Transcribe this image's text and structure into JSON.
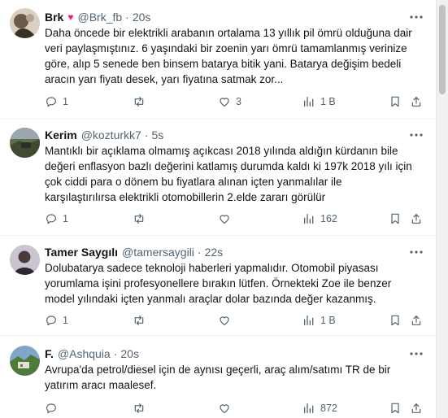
{
  "tweets": [
    {
      "name": "Brk",
      "heart": "♥",
      "handle": "@Brk_fb",
      "dot": "·",
      "time": "20s",
      "lines": [
        "Daha öncede bir elektrikli arabanın ortalama 13 yıllık pil ömrü olduğuna dair",
        "veri paylaşmıştınız. 6 yaşındaki bir zoenin yarı ömrü tamamlanmış verinize",
        "göre, alıp 5 senede ben binsem batarya bitik yani. Batarya değişim bedeli",
        "aracın yarı fiyatı desek, yarı fiyatına satmak zor..."
      ],
      "replies": "1",
      "retweets": "",
      "likes": "3",
      "views": "1 B"
    },
    {
      "name": "Kerim",
      "handle": "@kozturkk7",
      "dot": "·",
      "time": "5s",
      "lines": [
        "Mantıklı bir açıklama olmamış açıkcası 2018 yılında aldığın kürdanın bile",
        "değeri enflasyon bazlı değerini katlamış durumda kaldı ki 197k 2018 yılı için",
        "çok ciddi para o dönem bu fiyatlara alınan içten yanmalılar ile",
        "karşılaştırılırsa elektrikli otomobillerin 2.elde zararı görülür"
      ],
      "replies": "1",
      "retweets": "",
      "likes": "",
      "views": "162"
    },
    {
      "name": "Tamer Saygılı",
      "handle": "@tamersaygili",
      "dot": "·",
      "time": "22s",
      "lines": [
        "Dolubatarya sadece teknoloji haberleri yapmalıdır. Otomobil piyasası",
        "yorumlama işini profesyonellere bırakın lütfen. Örnekteki Zoe ile benzer",
        "model yılındaki içten yanmalı araçlar dolar bazında değer kazanmış."
      ],
      "replies": "1",
      "retweets": "",
      "likes": "",
      "views": "1 B"
    },
    {
      "name": "F.",
      "handle": "@Ashquia",
      "dot": "·",
      "time": "20s",
      "lines": [
        "Avrupa'da petrol/diesel için de aynısı geçerli, araç alım/satımı TR de bir",
        "yatırım aracı maalesef."
      ],
      "replies": "",
      "retweets": "",
      "likes": "",
      "views": "872"
    }
  ],
  "icons": {
    "reply": "reply-icon",
    "retweet": "retweet-icon",
    "like": "like-icon",
    "views": "views-icon",
    "bookmark": "bookmark-icon",
    "share": "share-icon",
    "more": "more-icon"
  },
  "colors": {
    "text": "#0f1419",
    "muted": "#536471",
    "heart": "#f91880",
    "divider": "#eff3f4"
  }
}
